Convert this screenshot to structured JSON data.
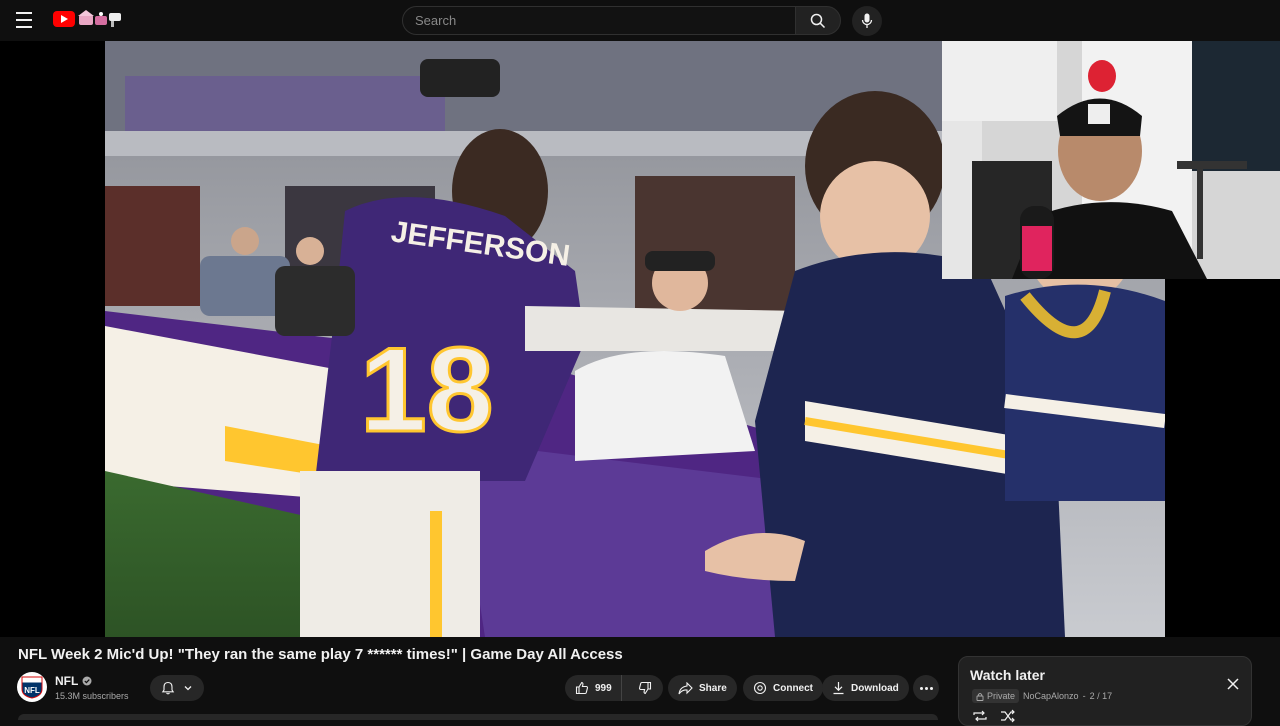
{
  "header": {
    "menu_icon": "hamburger-menu-icon",
    "logo_icon": "youtube-logo-icon",
    "search": {
      "placeholder": "Search"
    },
    "search_icon": "search-icon",
    "mic_icon": "microphone-icon"
  },
  "video": {
    "title": "NFL Week 2 Mic'd Up! \"They ran the same play 7 ****** times!\" | Game Day All Access",
    "jersey_name": "JEFFERSON",
    "jersey_number": "18"
  },
  "channel": {
    "name": "NFL",
    "subscribers": "15.3M subscribers",
    "verified_icon": "verified-check-icon"
  },
  "actions": {
    "like_count": "999",
    "share_label": "Share",
    "connect_label": "Connect",
    "download_label": "Download"
  },
  "playlist": {
    "title": "Watch later",
    "privacy": "Private",
    "owner": "NoCapAlonzo",
    "position": "2 / 17",
    "separator": "-"
  },
  "colors": {
    "background": "#0f0f0f",
    "brand_red": "#ff0000",
    "vikings_purple": "#4f2683",
    "vikings_gold": "#ffc62f"
  }
}
